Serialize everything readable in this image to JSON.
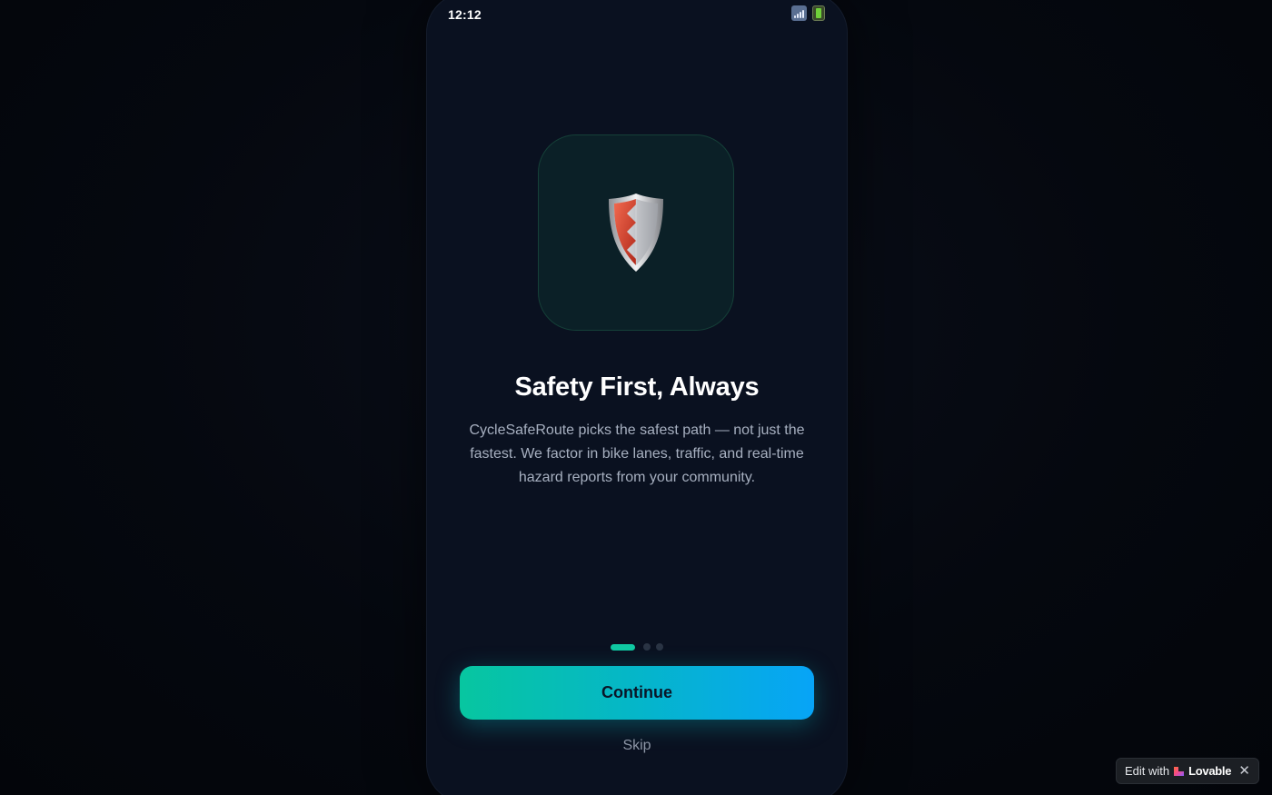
{
  "status_bar": {
    "time": "12:12",
    "icons": [
      "signal-icon",
      "battery-icon"
    ]
  },
  "onboarding": {
    "hero_icon": "shield-icon",
    "title": "Safety First, Always",
    "description": "CycleSafeRoute picks the safest path — not just the fastest. We factor in bike lanes, traffic, and real-time hazard reports from your community.",
    "pager": {
      "total_pages": 3,
      "active_page": 1
    },
    "continue_label": "Continue",
    "skip_label": "Skip"
  },
  "badge": {
    "edit_label": "Edit with",
    "brand": "Lovable",
    "close_label": "✕"
  },
  "colors": {
    "accent_start": "#07c6a0",
    "accent_end": "#07a4f7",
    "background": "#0a1120",
    "text_primary": "#ffffff",
    "text_secondary": "#a7b0c0"
  }
}
